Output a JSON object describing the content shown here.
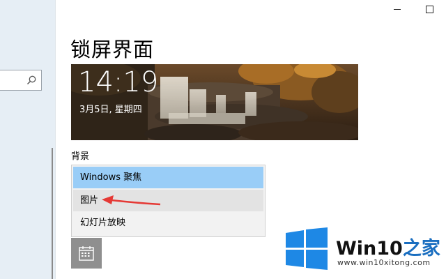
{
  "window": {
    "minimize_icon": "minimize-icon",
    "maximize_icon": "maximize-icon"
  },
  "sidebar": {
    "search_icon": "search-icon"
  },
  "page": {
    "title": "锁屏界面"
  },
  "preview": {
    "time": "14:19",
    "date": "3月5日, 星期四",
    "image": "waterfall-autumn-forest"
  },
  "background": {
    "label": "背景",
    "options": [
      "Windows 聚焦",
      "图片",
      "幻灯片放映"
    ],
    "highlighted": "Windows 聚焦",
    "annotated": "图片",
    "annotation_color": "#e53935"
  },
  "tile_icon": "calendar-icon",
  "watermark": {
    "brand_prefix": "Win10",
    "brand_suffix": "之家",
    "url": "www.win10xitong.com",
    "colors": {
      "logo": "#1e88e5",
      "suffix": "#1a6ec0"
    }
  }
}
